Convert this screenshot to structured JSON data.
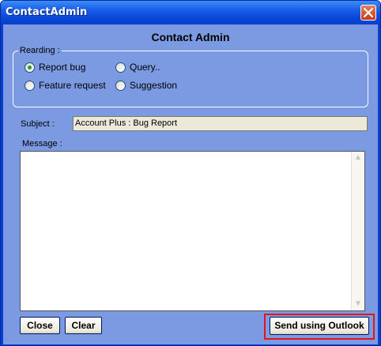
{
  "window": {
    "title": "ContactAdmin"
  },
  "dialog": {
    "heading": "Contact Admin",
    "regarding": {
      "label": "Rearding :",
      "options": [
        {
          "id": "report-bug",
          "label": "Report bug",
          "selected": true
        },
        {
          "id": "query",
          "label": "Query..",
          "selected": false
        },
        {
          "id": "feature-request",
          "label": "Feature request",
          "selected": false
        },
        {
          "id": "suggestion",
          "label": "Suggestion",
          "selected": false
        }
      ]
    },
    "subject": {
      "label": "Subject :",
      "value": "Account Plus : Bug Report"
    },
    "message": {
      "label": "Message :",
      "value": ""
    }
  },
  "buttons": {
    "close": "Close",
    "clear": "Clear",
    "send": "Send using Outlook"
  },
  "icons": {
    "close": "close-x-icon",
    "scroll_up": "scroll-up-arrow-icon",
    "scroll_down": "scroll-down-arrow-icon"
  },
  "colors": {
    "titlebar": "#0a48d8",
    "client_bg": "#7b9ae2",
    "highlight": "#e01818"
  }
}
